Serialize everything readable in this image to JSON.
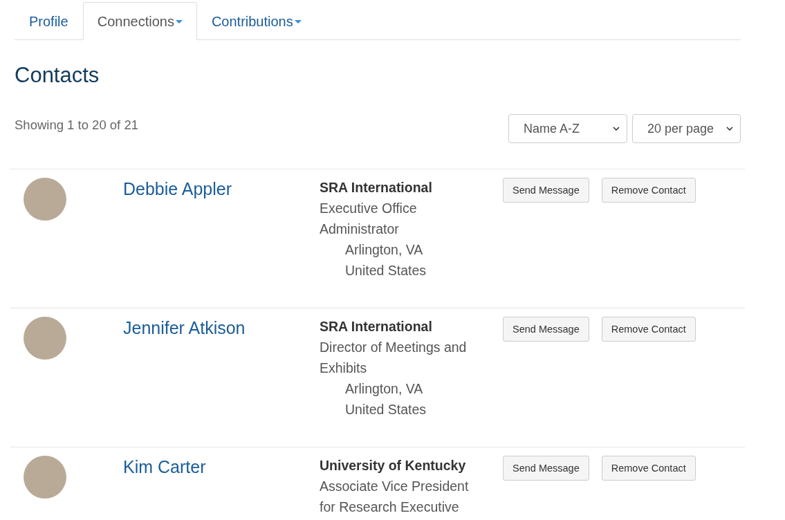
{
  "tabs": [
    {
      "label": "Profile",
      "selected": false,
      "has_menu": false
    },
    {
      "label": "Connections",
      "selected": true,
      "has_menu": true
    },
    {
      "label": "Contributions",
      "selected": false,
      "has_menu": true
    }
  ],
  "heading": "Contacts",
  "summary": "Showing 1 to 20 of 21",
  "sort_select": {
    "value": "Name A-Z"
  },
  "page_size_select": {
    "value": "20 per page"
  },
  "contacts": [
    {
      "name": "Debbie Appler",
      "organization": "SRA International",
      "title": "Executive Office Administrator",
      "city": "Arlington, VA",
      "country": "United States",
      "buttons": [
        "Send Message",
        "Remove Contact"
      ]
    },
    {
      "name": "Jennifer Atkison",
      "organization": "SRA International",
      "title": "Director of Meetings and Exhibits",
      "city": "Arlington, VA",
      "country": "United States",
      "buttons": [
        "Send Message",
        "Remove Contact"
      ]
    },
    {
      "name": "Kim Carter",
      "organization": "University of Kentucky",
      "title": "Associate Vice President for Research Executive",
      "buttons": [
        "Send Message",
        "Remove Contact"
      ]
    }
  ]
}
